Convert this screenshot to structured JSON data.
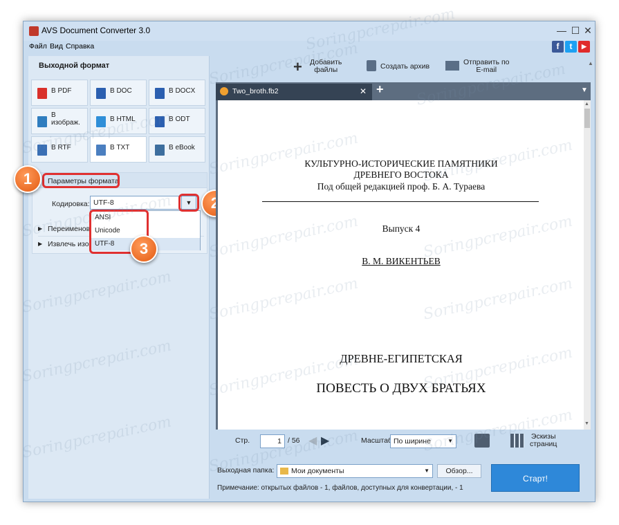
{
  "window": {
    "title": "AVS Document Converter 3.0",
    "controls": {
      "minimize": "—",
      "maximize": "☐",
      "close": "✕"
    }
  },
  "menu": [
    "Файл",
    "Вид",
    "Справка"
  ],
  "social": [
    {
      "name": "facebook-icon",
      "glyph": "f",
      "color": "#3b5998"
    },
    {
      "name": "twitter-icon",
      "glyph": "t",
      "color": "#1da1f2"
    },
    {
      "name": "youtube-icon",
      "glyph": "▶",
      "color": "#e02b2b"
    }
  ],
  "left_panel": {
    "title": "Выходной формат",
    "formats": [
      {
        "label": "В PDF",
        "icon": "pdf-icon",
        "color": "#d9302b"
      },
      {
        "label": "В DOC",
        "icon": "doc-icon",
        "color": "#2b5fb0"
      },
      {
        "label": "В DOCX",
        "icon": "docx-icon",
        "color": "#2b5fb0"
      },
      {
        "label": "В изображ.",
        "icon": "image-icon",
        "color": "#2f7dbf"
      },
      {
        "label": "В HTML",
        "icon": "html-icon",
        "color": "#2f8fd8"
      },
      {
        "label": "В ODT",
        "icon": "odt-icon",
        "color": "#2b5fb0"
      },
      {
        "label": "В RTF",
        "icon": "rtf-icon",
        "color": "#3a6fb4"
      },
      {
        "label": "В TXT",
        "icon": "txt-icon",
        "color": "#4b7fc0"
      },
      {
        "label": "В eBook",
        "icon": "ebook-icon",
        "color": "#3d6e9e"
      }
    ],
    "format_params": {
      "title": "Параметры формата",
      "encoding_label": "Кодировка:",
      "encoding_value": "UTF-8",
      "options": [
        "ANSI",
        "Unicode",
        "UTF-8"
      ],
      "rows": [
        "Переименова",
        "Извлечь изоб"
      ]
    }
  },
  "toolbar": {
    "add_files": "Добавить\nфайлы",
    "create_archive": "Создать архив",
    "send_email": "Отправить по\nE-mail"
  },
  "tab": {
    "name": "Two_broth.fb2",
    "close": "✕",
    "add": "+"
  },
  "document": {
    "line1": "КУЛЬТУРНО-ИСТОРИЧЕСКИЕ ПАМЯТНИКИ",
    "line2": "ДРЕВНЕГО ВОСТОКА",
    "line3": "Под общей редакцией проф. Б. А. Тураева",
    "issue": "Выпуск 4",
    "author": "В. М. ВИКЕНТЬЕВ",
    "heading1": "ДРЕВНЕ-ЕГИПЕТСКАЯ",
    "heading2": "ПОВЕСТЬ О ДВУХ БРАТЬЯХ"
  },
  "navigation": {
    "page_label": "Стр.",
    "page_current": "1",
    "page_total": "/ 56",
    "zoom_label": "Масштаб",
    "zoom_value": "По ширине",
    "thumbnails": "Эскизы\nстраниц"
  },
  "output": {
    "folder_label": "Выходная папка:",
    "folder_value": "Мои документы",
    "browse": "Обзор...",
    "note": "Примечание: открытых файлов - 1, файлов, доступных для конвертации, - 1",
    "start": "Старт!"
  },
  "annotations": [
    "1",
    "2",
    "3"
  ],
  "watermark": "Soringpcrepair.com"
}
